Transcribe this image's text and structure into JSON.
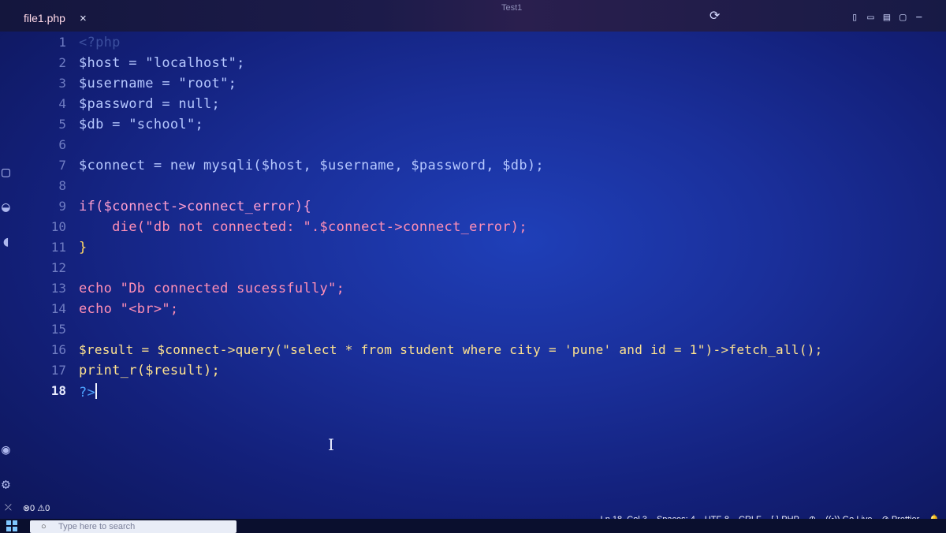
{
  "window": {
    "title": "Test1"
  },
  "tab": {
    "label": "file1.php",
    "close": "×"
  },
  "editor": {
    "line_numbers": [
      "1",
      "2",
      "3",
      "4",
      "5",
      "6",
      "7",
      "8",
      "9",
      "10",
      "11",
      "12",
      "13",
      "14",
      "15",
      "16",
      "17",
      "18"
    ],
    "lines": [
      "<?php",
      "$host = \"localhost\";",
      "$username = \"root\";",
      "$password = null;",
      "$db = \"school\";",
      "",
      "$connect = new mysqli($host, $username, $password, $db);",
      "",
      "if($connect->connect_error){",
      "    die(\"db not connected: \".$connect->connect_error);",
      "}",
      "",
      "echo \"Db connected sucessfully\";",
      "echo \"<br>\";",
      "",
      "$result = $connect->query(\"select * from student where city = 'pune' and id = 1\")->fetch_all();",
      "print_r($result);",
      "?>"
    ],
    "active_line": "18"
  },
  "statusbar": {
    "errors": "0",
    "warnings": "0",
    "position": "Ln 18, Col 3",
    "spaces": "Spaces: 4",
    "encoding": "UTF-8",
    "eol": "CRLF",
    "language": "{ } PHP",
    "golive": "Go Live",
    "prettier": "Prettier"
  },
  "taskbar": {
    "search_placeholder": "Type here to search"
  },
  "colors": {
    "background": "#1a2f9a",
    "string": "#ff8fb6",
    "keyword": "#ff9fd0",
    "function": "#ffe38f"
  }
}
